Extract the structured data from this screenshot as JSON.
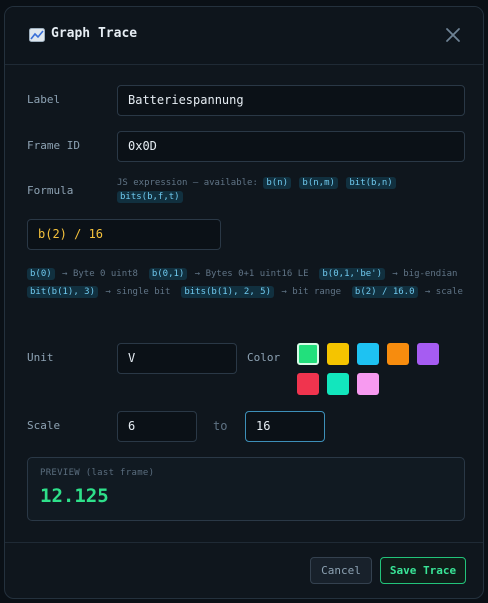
{
  "dialog": {
    "title": "Graph Trace",
    "icon": "chart-line-icon"
  },
  "fields": {
    "label": {
      "label": "Label",
      "value": "Batteriespannung"
    },
    "frame_id": {
      "label": "Frame ID",
      "value": "0x0D"
    },
    "formula": {
      "label": "Formula",
      "hint_prefix": "JS expression — available:",
      "hint_chips": [
        "b(n)",
        "b(n,m)",
        "bit(b,n)",
        "bits(b,f,t)"
      ],
      "value": "b(2) / 16"
    },
    "help": [
      {
        "code": "b(0)",
        "desc": "→ Byte 0 uint8"
      },
      {
        "code": "b(0,1)",
        "desc": "→ Bytes 0+1 uint16 LE"
      },
      {
        "code": "b(0,1,'be')",
        "desc": "→ big-endian"
      },
      {
        "code": "bit(b(1), 3)",
        "desc": "→ single bit"
      },
      {
        "code": "bits(b(1), 2, 5)",
        "desc": "→ bit range"
      },
      {
        "code": "b(2) / 16.0",
        "desc": "→ scale"
      }
    ],
    "unit": {
      "label": "Unit",
      "value": "V"
    },
    "color": {
      "label": "Color",
      "options": [
        "#22e07c",
        "#f5c400",
        "#1ec2f2",
        "#f78c0e",
        "#a65cf2",
        "#f0344e",
        "#12e6bd",
        "#f79af0"
      ],
      "selected_index": 0
    },
    "scale": {
      "label": "Scale",
      "min": "6",
      "to_label": "to",
      "max": "16"
    }
  },
  "preview": {
    "label": "PREVIEW (last frame)",
    "value": "12.125"
  },
  "footer": {
    "cancel_label": "Cancel",
    "save_label": "Save Trace"
  }
}
